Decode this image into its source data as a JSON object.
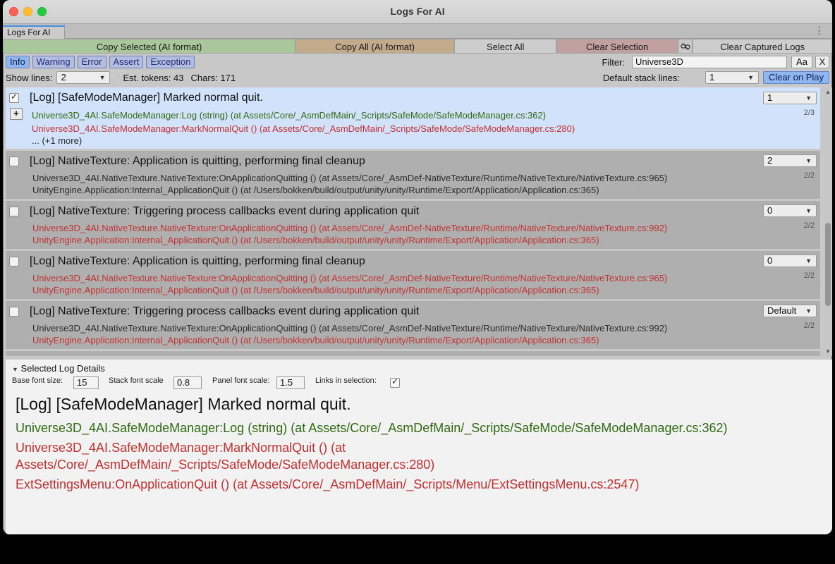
{
  "window": {
    "title": "Logs For AI",
    "tab": "Logs For AI"
  },
  "toolbar": {
    "copy_selected": "Copy Selected (AI format)",
    "copy_all": "Copy All (AI format)",
    "select_all": "Select All",
    "clear_selection": "Clear Selection",
    "clear_captured": "Clear Captured Logs"
  },
  "levels": [
    "Info",
    "Warning",
    "Error",
    "Assert",
    "Exception"
  ],
  "filter": {
    "label": "Filter:",
    "value": "Universe3D",
    "case_btn": "Aa",
    "clear_btn": "X"
  },
  "status": {
    "show_lines_label": "Show lines:",
    "show_lines_value": "2",
    "est_tokens": "Est. tokens: 43",
    "chars": "Chars: 171",
    "default_stack_label": "Default stack lines:",
    "default_stack_value": "1",
    "clear_on_play": "Clear on Play"
  },
  "logs": [
    {
      "title": "[Log] [SafeModeManager] Marked normal quit.",
      "lines": "1",
      "count": "2/3",
      "stack": [
        "Universe3D_4AI.SafeModeManager:Log (string) (at Assets/Core/_AsmDefMain/_Scripts/SafeMode/SafeModeManager.cs:362)",
        "Universe3D_4AI.SafeModeManager:MarkNormalQuit () (at Assets/Core/_AsmDefMain/_Scripts/SafeMode/SafeModeManager.cs:280)"
      ],
      "more": "... (+1 more)"
    },
    {
      "title": "[Log] NativeTexture: Application is quitting, performing final cleanup",
      "lines": "2",
      "count": "2/2",
      "stack": [
        "Universe3D_4AI.NativeTexture.NativeTexture:OnApplicationQuitting () (at Assets/Core/_AsmDef-NativeTexture/Runtime/NativeTexture/NativeTexture.cs:965)",
        "UnityEngine.Application:Internal_ApplicationQuit () (at /Users/bokken/build/output/unity/unity/Runtime/Export/Application/Application.cs:365)"
      ]
    },
    {
      "title": "[Log] NativeTexture: Triggering process callbacks event during application quit",
      "lines": "0",
      "count": "2/2",
      "stack": [
        "Universe3D_4AI.NativeTexture.NativeTexture:OnApplicationQuitting () (at Assets/Core/_AsmDef-NativeTexture/Runtime/NativeTexture/NativeTexture.cs:992)",
        "UnityEngine.Application:Internal_ApplicationQuit () (at /Users/bokken/build/output/unity/unity/Runtime/Export/Application/Application.cs:365)"
      ]
    },
    {
      "title": "[Log] NativeTexture: Application is quitting, performing final cleanup",
      "lines": "0",
      "count": "2/2",
      "stack": [
        "Universe3D_4AI.NativeTexture.NativeTexture:OnApplicationQuitting () (at Assets/Core/_AsmDef-NativeTexture/Runtime/NativeTexture/NativeTexture.cs:965)",
        "UnityEngine.Application:Internal_ApplicationQuit () (at /Users/bokken/build/output/unity/unity/Runtime/Export/Application/Application.cs:365)"
      ]
    },
    {
      "title": "[Log] NativeTexture: Triggering process callbacks event during application quit",
      "lines": "Default",
      "count": "2/2",
      "stack": [
        "Universe3D_4AI.NativeTexture.NativeTexture:OnApplicationQuitting () (at Assets/Core/_AsmDef-NativeTexture/Runtime/NativeTexture/NativeTexture.cs:992)",
        "UnityEngine.Application:Internal_ApplicationQuit () (at /Users/bokken/build/output/unity/unity/Runtime/Export/Application/Application.cs:365)"
      ]
    }
  ],
  "details": {
    "header": "Selected Log Details",
    "base_font_label": "Base font size:",
    "base_font_value": "15",
    "stack_scale_label": "Stack font scale",
    "stack_scale_value": "0.8",
    "panel_scale_label": "Panel font scale:",
    "panel_scale_value": "1.5",
    "links_label": "Links in selection:",
    "title": "[Log] [SafeModeManager] Marked normal quit.",
    "line1": "Universe3D_4AI.SafeModeManager:Log (string) (at Assets/Core/_AsmDefMain/_Scripts/SafeMode/SafeModeManager.cs:362)",
    "line2a": "Universe3D_4AI.SafeModeManager:MarkNormalQuit () (at",
    "line2b": "Assets/Core/_AsmDefMain/_Scripts/SafeMode/SafeModeManager.cs:280)",
    "line3": "ExtSettingsMenu:OnApplicationQuit () (at Assets/Core/_AsmDefMain/_Scripts/Menu/ExtSettingsMenu.cs:2547)"
  },
  "colors": {
    "green": "#2f6b12",
    "red": "#c33030",
    "selected_bg": "#d2e2fb",
    "accent": "#4a8fe0"
  }
}
